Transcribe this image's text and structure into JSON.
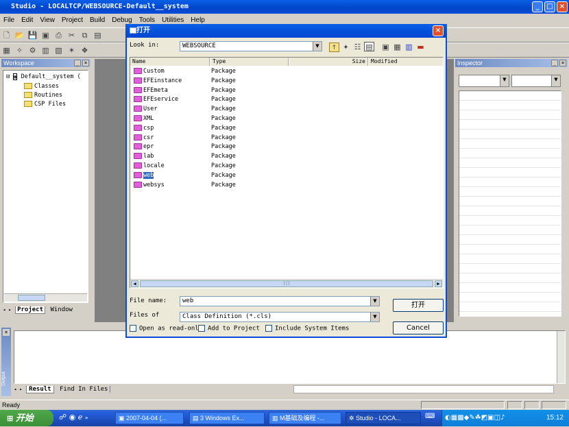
{
  "window": {
    "title": "Studio - LOCALTCP/WEBSOURCE-Default__system"
  },
  "menu": [
    "File",
    "Edit",
    "View",
    "Project",
    "Build",
    "Debug",
    "Tools",
    "Utilities",
    "Help"
  ],
  "workspace": {
    "title": "Workspace",
    "root": "Default__system",
    "children": [
      "Classes",
      "Routines",
      "CSP Files"
    ],
    "tabs": [
      "Project",
      "Window"
    ]
  },
  "inspector": {
    "title": "Inspector"
  },
  "output": {
    "side_label": "Output",
    "tabs": [
      "Result",
      "Find In Files"
    ]
  },
  "status": {
    "text": "Ready"
  },
  "dialog": {
    "title": "打开",
    "look_in_label": "Look in:",
    "look_in_value": "WEBSOURCE",
    "columns": [
      "Name",
      "Type",
      "Size",
      "Modified"
    ],
    "items": [
      {
        "name": "Custom",
        "type": "Package"
      },
      {
        "name": "EFEinstance",
        "type": "Package"
      },
      {
        "name": "EFEmeta",
        "type": "Package"
      },
      {
        "name": "EFEservice",
        "type": "Package"
      },
      {
        "name": "User",
        "type": "Package"
      },
      {
        "name": "XML",
        "type": "Package"
      },
      {
        "name": "csp",
        "type": "Package"
      },
      {
        "name": "csr",
        "type": "Package"
      },
      {
        "name": "epr",
        "type": "Package"
      },
      {
        "name": "lab",
        "type": "Package"
      },
      {
        "name": "locale",
        "type": "Package"
      },
      {
        "name": "web",
        "type": "Package"
      },
      {
        "name": "websys",
        "type": "Package"
      }
    ],
    "selected_index": 11,
    "file_name_label": "File name:",
    "file_name_value": "web",
    "files_of_label": "Files of",
    "files_of_value": "Class Definition (*.cls)",
    "open_button": "打开",
    "cancel_button": "Cancel",
    "checkboxes": [
      "Open as read-only",
      "Add to Project",
      "Include System Items"
    ]
  },
  "taskbar": {
    "start": "开始",
    "tasks": [
      "2007-04-04 (...",
      "3 Windows Ex...",
      "M基础及编程 -...",
      "Studio - LOCA..."
    ],
    "clock": "15:12"
  }
}
